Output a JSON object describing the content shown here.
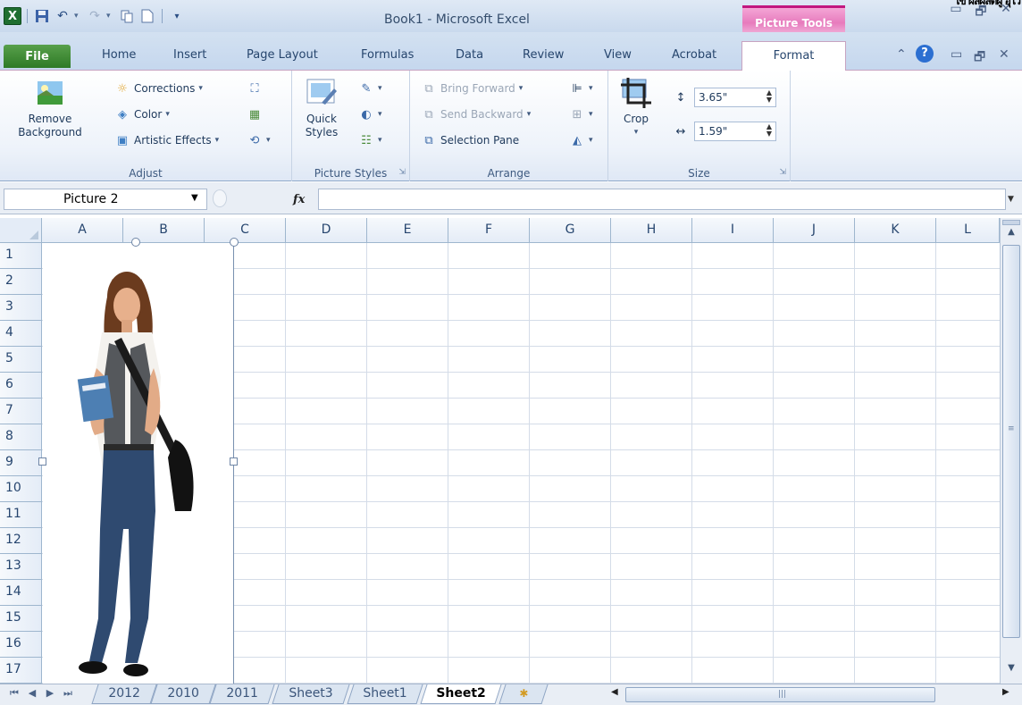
{
  "window": {
    "title": "Book1 - Microsoft Excel",
    "contextual_tab_group": "Picture Tools",
    "corner_text": "ไข้ ผลผลิตผู้ อุโว"
  },
  "quick_access": {
    "icons": [
      "excel-icon",
      "save-icon",
      "undo-icon",
      "redo-icon",
      "copy-icon",
      "new-icon",
      "customize-icon"
    ]
  },
  "tabs": [
    {
      "label": "File"
    },
    {
      "label": "Home"
    },
    {
      "label": "Insert"
    },
    {
      "label": "Page Layout"
    },
    {
      "label": "Formulas"
    },
    {
      "label": "Data"
    },
    {
      "label": "Review"
    },
    {
      "label": "View"
    },
    {
      "label": "Acrobat"
    },
    {
      "label": "Format"
    }
  ],
  "ribbon": {
    "adjust": {
      "label": "Adjust",
      "remove_background": "Remove Background",
      "corrections": "Corrections",
      "color": "Color",
      "artistic_effects": "Artistic Effects"
    },
    "picture_styles": {
      "label": "Picture Styles",
      "quick_styles": "Quick Styles"
    },
    "arrange": {
      "label": "Arrange",
      "bring_forward": "Bring Forward",
      "send_backward": "Send Backward",
      "selection_pane": "Selection Pane"
    },
    "size": {
      "label": "Size",
      "crop": "Crop",
      "height": "3.65\"",
      "width": "1.59\""
    }
  },
  "formula_bar": {
    "name_box": "Picture 2",
    "fx_label": "fx",
    "formula": ""
  },
  "grid": {
    "columns": [
      "A",
      "B",
      "C",
      "D",
      "E",
      "F",
      "G",
      "H",
      "I",
      "J",
      "K",
      "L"
    ],
    "rows": [
      "1",
      "2",
      "3",
      "4",
      "5",
      "6",
      "7",
      "8",
      "9",
      "10",
      "11",
      "12",
      "13",
      "14",
      "15",
      "16",
      "17"
    ]
  },
  "sheet_tabs": [
    {
      "label": "2012",
      "active": false
    },
    {
      "label": "2010",
      "active": false
    },
    {
      "label": "2011",
      "active": false
    },
    {
      "label": "Sheet3",
      "active": false
    },
    {
      "label": "Sheet1",
      "active": false
    },
    {
      "label": "Sheet2",
      "active": true
    }
  ],
  "colors": {
    "file_tab": "#2e7a26",
    "picture_tools": "#e77bbd",
    "grid_line": "#d4dce8",
    "header_bg": "#e4ecf7"
  }
}
